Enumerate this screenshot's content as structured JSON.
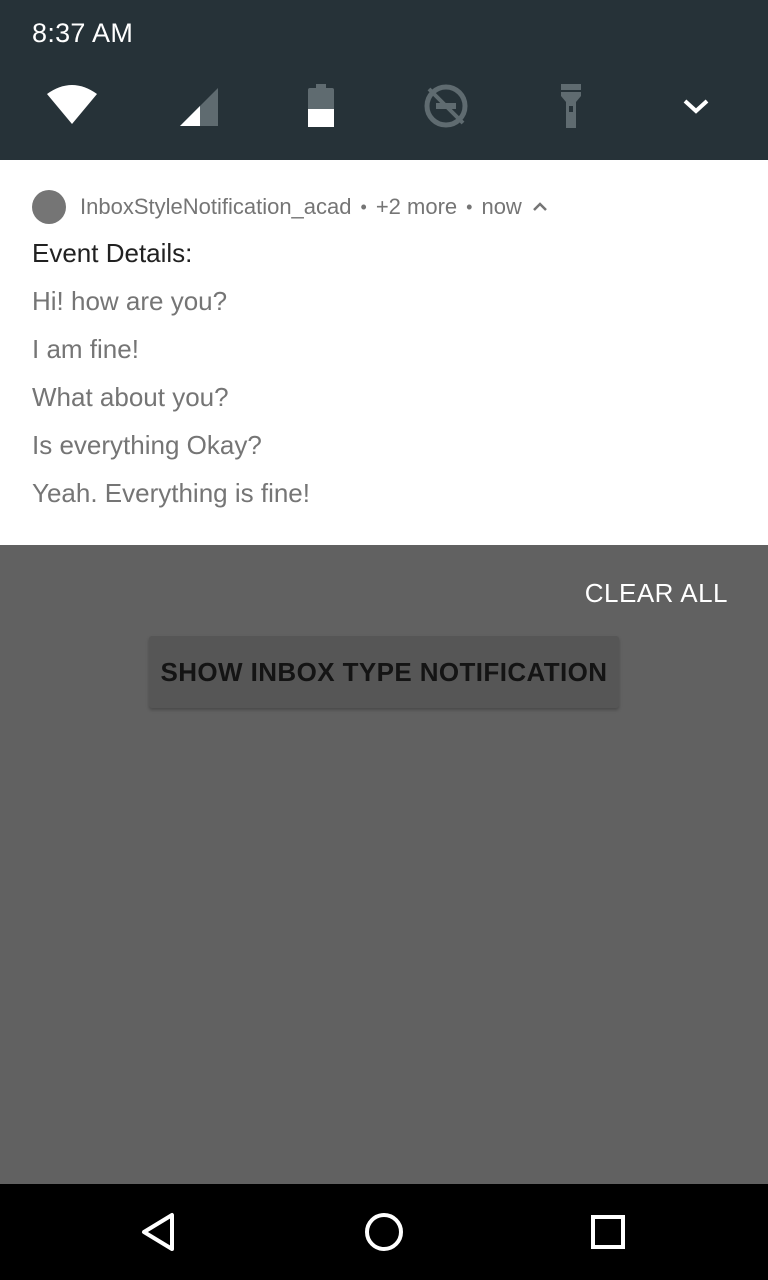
{
  "status_bar": {
    "time": "8:37 AM"
  },
  "quick_settings": {
    "icons": [
      "wifi-icon",
      "cell-signal-icon",
      "battery-icon",
      "data-saver-off-icon",
      "flashlight-icon",
      "expand-chevron-icon"
    ]
  },
  "notification": {
    "app_name": "InboxStyleNotification_acad",
    "separator": "•",
    "more": "+2 more",
    "time": "now",
    "title": "Event Details:",
    "lines": [
      "Hi! how are you?",
      "I am fine!",
      "What about you?",
      "Is everything Okay?",
      "Yeah. Everything is fine!"
    ]
  },
  "shade_actions": {
    "clear_all": "CLEAR ALL"
  },
  "app": {
    "button_label": "SHOW INBOX TYPE NOTIFICATION"
  },
  "nav_bar": {
    "buttons": [
      "back-icon",
      "home-icon",
      "recents-icon"
    ]
  },
  "colors": {
    "shade_bg": "#263238",
    "scrim_bg": "#616161",
    "notification_bg": "#ffffff",
    "secondary_text": "#757575",
    "primary_text": "#212121"
  }
}
